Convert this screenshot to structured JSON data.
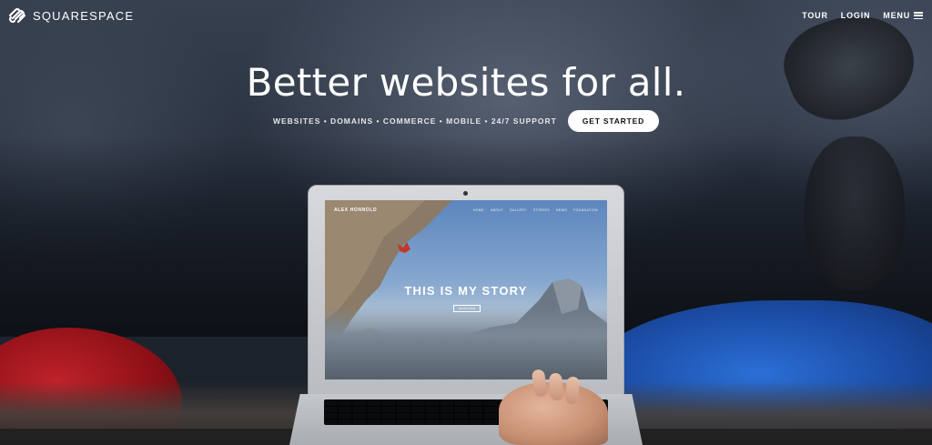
{
  "brand": {
    "name": "SQUARESPACE",
    "logo_icon": "squarespace-logo-icon"
  },
  "nav": {
    "tour": "TOUR",
    "login": "LOGIN",
    "menu": "MENU",
    "menu_icon": "hamburger-icon"
  },
  "hero": {
    "headline": "Better websites for all.",
    "features": "WEBSITES • DOMAINS • COMMERCE • MOBILE • 24/7 SUPPORT",
    "cta_label": "GET STARTED"
  },
  "laptop_screen": {
    "site_name": "ALEX HONNOLD",
    "nav_items": [
      "HOME",
      "ABOUT",
      "GALLERY",
      "STORIES",
      "NEWS",
      "FOUNDATION"
    ],
    "headline": "THIS IS MY STORY",
    "button_label": "WATCH FILM"
  },
  "colors": {
    "text": "#ffffff",
    "cta_background": "#ffffff",
    "cta_text": "#111111"
  }
}
